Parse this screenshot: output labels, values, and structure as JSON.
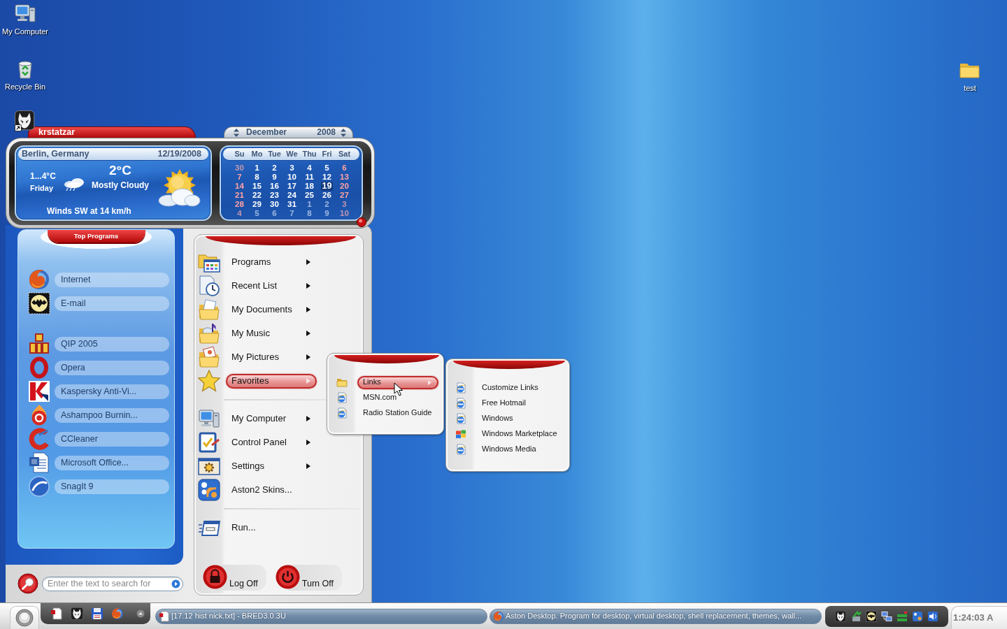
{
  "desktop_icons": [
    {
      "label": "My Computer"
    },
    {
      "label": "Recycle Bin"
    },
    {
      "label": "test"
    }
  ],
  "widget": {
    "user": "krstatzar",
    "weather": {
      "location": "Berlin, Germany",
      "date": "12/19/2008",
      "temperature": "2°C",
      "range": "1...4°C",
      "day": "Friday",
      "condition": "Mostly Cloudy",
      "wind": "Winds SW at 14 km/h"
    },
    "calendar": {
      "month": "December",
      "year": "2008",
      "weekdays": [
        {
          "label": "Su",
          "weekend": true
        },
        {
          "label": "Mo",
          "weekend": false
        },
        {
          "label": "Tue",
          "weekend": false
        },
        {
          "label": "We",
          "weekend": false
        },
        {
          "label": "Thu",
          "weekend": false
        },
        {
          "label": "Fri",
          "weekend": false
        },
        {
          "label": "Sat",
          "weekend": true
        }
      ],
      "weeks": [
        [
          {
            "day": "30",
            "in_month": false,
            "selected": false
          },
          {
            "day": "1",
            "in_month": true,
            "selected": false
          },
          {
            "day": "2",
            "in_month": true,
            "selected": false
          },
          {
            "day": "3",
            "in_month": true,
            "selected": false
          },
          {
            "day": "4",
            "in_month": true,
            "selected": false
          },
          {
            "day": "5",
            "in_month": true,
            "selected": false
          },
          {
            "day": "6",
            "in_month": true,
            "selected": false
          }
        ],
        [
          {
            "day": "7",
            "in_month": true,
            "selected": false
          },
          {
            "day": "8",
            "in_month": true,
            "selected": false
          },
          {
            "day": "9",
            "in_month": true,
            "selected": false
          },
          {
            "day": "10",
            "in_month": true,
            "selected": false
          },
          {
            "day": "11",
            "in_month": true,
            "selected": false
          },
          {
            "day": "12",
            "in_month": true,
            "selected": false
          },
          {
            "day": "13",
            "in_month": true,
            "selected": false
          }
        ],
        [
          {
            "day": "14",
            "in_month": true,
            "selected": false
          },
          {
            "day": "15",
            "in_month": true,
            "selected": false
          },
          {
            "day": "16",
            "in_month": true,
            "selected": false
          },
          {
            "day": "17",
            "in_month": true,
            "selected": false
          },
          {
            "day": "18",
            "in_month": true,
            "selected": false
          },
          {
            "day": "19",
            "in_month": true,
            "selected": true
          },
          {
            "day": "20",
            "in_month": true,
            "selected": false
          }
        ],
        [
          {
            "day": "21",
            "in_month": true,
            "selected": false
          },
          {
            "day": "22",
            "in_month": true,
            "selected": false
          },
          {
            "day": "23",
            "in_month": true,
            "selected": false
          },
          {
            "day": "24",
            "in_month": true,
            "selected": false
          },
          {
            "day": "25",
            "in_month": true,
            "selected": false
          },
          {
            "day": "26",
            "in_month": true,
            "selected": false
          },
          {
            "day": "27",
            "in_month": true,
            "selected": false
          }
        ],
        [
          {
            "day": "28",
            "in_month": true,
            "selected": false
          },
          {
            "day": "29",
            "in_month": true,
            "selected": false
          },
          {
            "day": "30",
            "in_month": true,
            "selected": false
          },
          {
            "day": "31",
            "in_month": true,
            "selected": false
          },
          {
            "day": "1",
            "in_month": false,
            "selected": false
          },
          {
            "day": "2",
            "in_month": false,
            "selected": false
          },
          {
            "day": "3",
            "in_month": false,
            "selected": false
          }
        ],
        [
          {
            "day": "4",
            "in_month": false,
            "selected": false
          },
          {
            "day": "5",
            "in_month": false,
            "selected": false
          },
          {
            "day": "6",
            "in_month": false,
            "selected": false
          },
          {
            "day": "7",
            "in_month": false,
            "selected": false
          },
          {
            "day": "8",
            "in_month": false,
            "selected": false
          },
          {
            "day": "9",
            "in_month": false,
            "selected": false
          },
          {
            "day": "10",
            "in_month": false,
            "selected": false
          }
        ]
      ]
    }
  },
  "top_programs": {
    "title": "Top Programs",
    "groups": [
      [
        {
          "label": "Internet"
        },
        {
          "label": "E-mail"
        }
      ],
      [
        {
          "label": "QIP 2005"
        },
        {
          "label": "Opera"
        },
        {
          "label": "Kaspersky Anti-Vi..."
        },
        {
          "label": "Ashampoo Burnin..."
        },
        {
          "label": "CCleaner"
        },
        {
          "label": "Microsoft Office..."
        },
        {
          "label": "SnagIt 9"
        }
      ]
    ]
  },
  "search": {
    "placeholder": "Enter the text to search for"
  },
  "main_menu": {
    "groups": [
      [
        {
          "label": "Programs",
          "has_submenu": true,
          "selected": false
        },
        {
          "label": "Recent List",
          "has_submenu": true,
          "selected": false
        },
        {
          "label": "My Documents",
          "has_submenu": true,
          "selected": false
        },
        {
          "label": "My Music",
          "has_submenu": true,
          "selected": false
        },
        {
          "label": "My Pictures",
          "has_submenu": true,
          "selected": false
        },
        {
          "label": "Favorites",
          "has_submenu": true,
          "selected": true
        }
      ],
      [
        {
          "label": "My Computer",
          "has_submenu": true,
          "selected": false
        },
        {
          "label": "Control Panel",
          "has_submenu": true,
          "selected": false
        },
        {
          "label": "Settings",
          "has_submenu": true,
          "selected": false
        },
        {
          "label": "Aston2 Skins...",
          "has_submenu": false,
          "selected": false
        }
      ],
      [
        {
          "label": "Run...",
          "has_submenu": false,
          "selected": false
        }
      ]
    ],
    "buttons": [
      {
        "label": "Log Off"
      },
      {
        "label": "Turn Off"
      }
    ]
  },
  "favorites_menu": {
    "items": [
      {
        "label": "Links",
        "has_submenu": true,
        "selected": true
      },
      {
        "label": "MSN.com",
        "has_submenu": false,
        "selected": false
      },
      {
        "label": "Radio Station Guide",
        "has_submenu": false,
        "selected": false
      }
    ]
  },
  "links_menu": {
    "items": [
      {
        "label": "Customize Links",
        "selected": false
      },
      {
        "label": "Free Hotmail",
        "selected": false
      },
      {
        "label": "Windows",
        "selected": false
      },
      {
        "label": "Windows Marketplace",
        "selected": false
      },
      {
        "label": "Windows Media",
        "selected": false
      }
    ]
  },
  "taskbar": {
    "tasks": [
      {
        "label": "[17.12 hist nick.txt] - BRED3.0.3U",
        "selected": false
      },
      {
        "label": "Aston Desktop. Program for desktop, virtual desktop, shell replacement, themes, wall...",
        "selected": false
      }
    ],
    "clock": "1:24:03 A"
  }
}
